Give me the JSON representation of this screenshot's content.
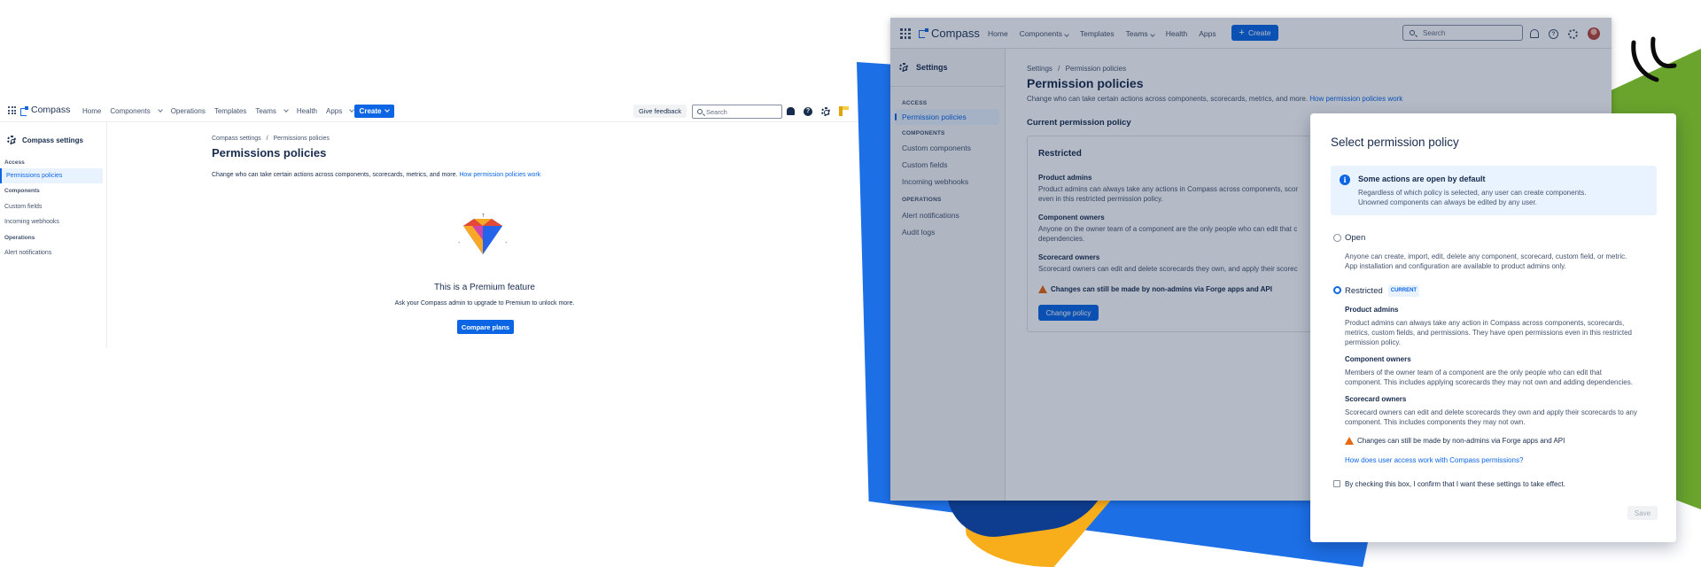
{
  "left_app": {
    "logo": "Compass",
    "nav": [
      "Home",
      "Components",
      "Operations",
      "Templates",
      "Teams",
      "Health",
      "Apps"
    ],
    "create_label": "Create",
    "feedback_label": "Give feedback",
    "search_placeholder": "Search",
    "sidebar": {
      "title": "Compass settings",
      "sections": [
        {
          "label": "Access",
          "items": [
            "Permissions policies"
          ]
        },
        {
          "label": "Components",
          "items": [
            "Custom fields",
            "Incoming webhooks"
          ]
        },
        {
          "label": "Operations",
          "items": [
            "Alert notifications"
          ]
        }
      ]
    },
    "breadcrumb": [
      "Compass settings",
      "/",
      "Permissions policies"
    ],
    "title": "Permissions policies",
    "description": "Change who can take certain actions across components, scorecards, metrics, and more.",
    "description_link": "How permission policies work",
    "premium_title": "This is a Premium feature",
    "premium_desc": "Ask your Compass admin to upgrade to Premium to unlock more.",
    "compare_label": "Compare plans"
  },
  "right_app": {
    "logo": "Compass",
    "nav": [
      "Home",
      "Components",
      "Templates",
      "Teams",
      "Health",
      "Apps"
    ],
    "create_label": "Create",
    "search_placeholder": "Search",
    "sidebar": {
      "title": "Settings",
      "sections": [
        {
          "label": "ACCESS",
          "items": [
            "Permission policies"
          ]
        },
        {
          "label": "COMPONENTS",
          "items": [
            "Custom components",
            "Custom fields",
            "Incoming webhooks"
          ]
        },
        {
          "label": "OPERATIONS",
          "items": [
            "Alert notifications",
            "Audit logs"
          ]
        }
      ]
    },
    "breadcrumb": [
      "Settings",
      "/",
      "Permission policies"
    ],
    "title": "Permission policies",
    "description": "Change who can take certain actions across components, scorecards, metrics, and more.",
    "description_link": "How permission policies work",
    "current_heading": "Current permission policy",
    "card": {
      "title": "Restricted",
      "product_admins_h": "Product admins",
      "product_admins_1": "Product admins can always take any actions in Compass across components, scor",
      "product_admins_2": "even in this restricted permission policy.",
      "component_owners_h": "Component owners",
      "component_owners_1": "Anyone on the owner team of a component are the only people who can edit that c",
      "component_owners_2": "dependencies.",
      "scorecard_owners_h": "Scorecard owners",
      "scorecard_owners_1": "Scorecard owners can edit and delete scorecards they own, and apply their scorec",
      "warning": "Changes can still be made by non-admins via Forge apps and API",
      "change_label": "Change policy"
    }
  },
  "modal": {
    "title": "Select permission policy",
    "info_title": "Some actions are open by default",
    "info_1": "Regardless of which policy is selected, any user can create components.",
    "info_2": "Unowned components can always be edited by any user.",
    "open_label": "Open",
    "open_1": "Anyone can create, import, edit, delete any component, scorecard, custom field, or metric.",
    "open_2": "App installation and configuration are available to product admins only.",
    "restricted_label": "Restricted",
    "current_badge": "CURRENT",
    "pa_h": "Product admins",
    "pa_1": "Product admins can always take any action in Compass across components, scorecards,",
    "pa_2": "metrics, custom fields, and permissions. They have open permissions even in this restricted",
    "pa_3": "permission policy.",
    "co_h": "Component owners",
    "co_1": "Members of the owner team of a component are the only people who can edit that",
    "co_2": "component. This includes applying scorecards they may not own and adding dependencies.",
    "so_h": "Scorecard owners",
    "so_1": "Scorecard owners can edit and delete scorecards they own and apply their scorecards to any",
    "so_2": "component. This includes components they may not own.",
    "warning": "Changes can still be made by non-admins via Forge apps and API",
    "link": "How does user access work with Compass permissions?",
    "confirm": "By checking this box, I confirm that I want these settings to take effect.",
    "save_label": "Save"
  },
  "colors": {
    "accent": "#0c66e4",
    "blue_shape": "#1d6fe6",
    "green_shape": "#6aa42c",
    "yellow_shape": "#f8ad1b",
    "warning": "#e56910"
  }
}
